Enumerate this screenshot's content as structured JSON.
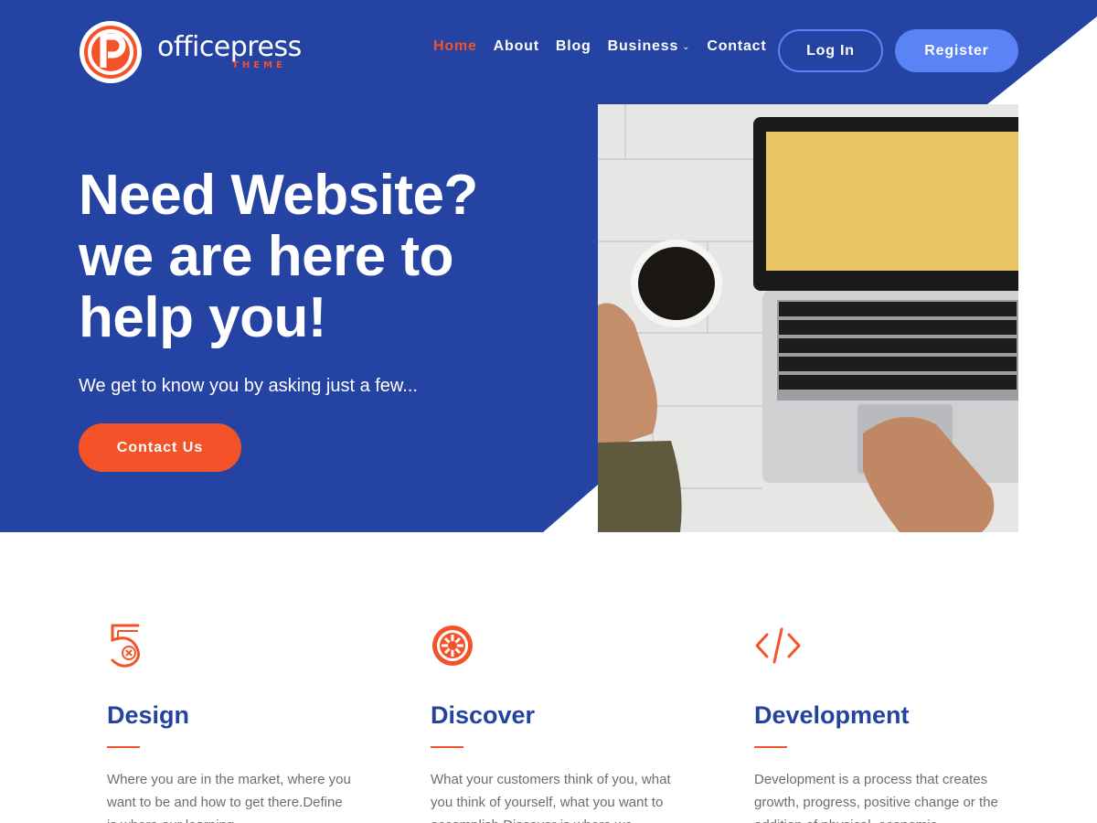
{
  "brand": {
    "logo_letter": "P",
    "name": "officepress",
    "tagline": "THEME"
  },
  "nav": {
    "items": [
      {
        "label": "Home",
        "active": true
      },
      {
        "label": "About",
        "active": false
      },
      {
        "label": "Blog",
        "active": false
      },
      {
        "label": "Business",
        "active": false,
        "has_dropdown": true
      },
      {
        "label": "Contact",
        "active": false
      }
    ],
    "login_label": "Log In",
    "register_label": "Register"
  },
  "hero": {
    "title_line1": "Need Website?",
    "title_line2": "we are here to",
    "title_line3": "help you!",
    "subtitle": "We get to know you by asking just a few...",
    "cta_label": "Contact Us"
  },
  "features": [
    {
      "icon": "number-five-icon",
      "title": "Design",
      "text": "Where you are in the market, where you want to be and how to get there.Define is where our learning"
    },
    {
      "icon": "gear-emblem-icon",
      "title": "Discover",
      "text": "What your customers think of you, what you think of yourself, what you want to accomplish.Discover is where we"
    },
    {
      "icon": "code-icon",
      "title": "Development",
      "text": "Development is a process that creates growth, progress, positive change or the addition of physical, economic"
    }
  ],
  "colors": {
    "hero_blue": "#2443a3",
    "accent_orange": "#f4532a",
    "button_blue": "#5b83f5",
    "heading_blue": "#24439f"
  }
}
